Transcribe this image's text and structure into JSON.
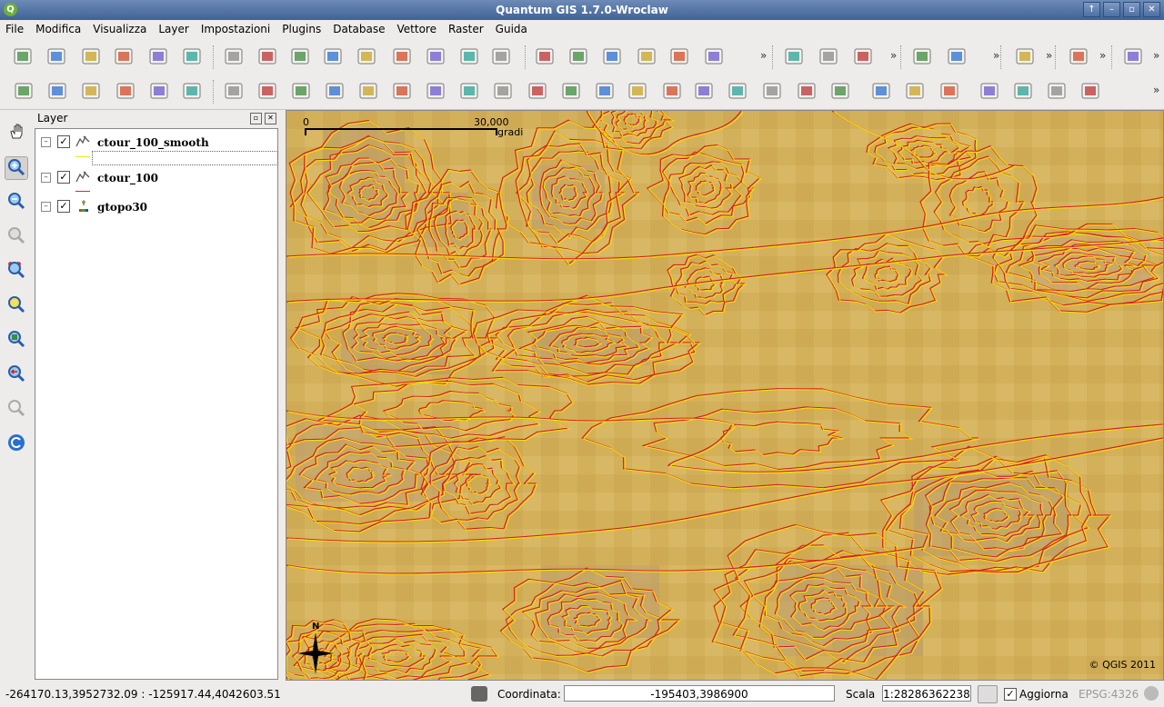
{
  "window": {
    "title": "Quantum GIS 1.7.0-Wroclaw",
    "controls": [
      "↑",
      "–",
      "▫",
      "✕"
    ]
  },
  "menu": [
    "File",
    "Modifica",
    "Visualizza",
    "Layer",
    "Impostazioni",
    "Plugins",
    "Database",
    "Vettore",
    "Raster",
    "Guida"
  ],
  "toolbar1_icons": [
    "new-project-icon",
    "open-project-icon",
    "save-project-icon",
    "save-as-icon",
    "print-composer-icon",
    "print-icon",
    "add-vector-layer-icon",
    "add-raster-layer-icon",
    "add-postgis-layer-icon",
    "add-spatialite-layer-icon",
    "add-wms-layer-icon",
    "new-shapefile-icon",
    "remove-layer-icon",
    "add-wfs-layer-icon",
    "gps-icon",
    "toggle-editing-icon",
    "save-edits-icon",
    "move-feature-icon",
    "node-tool-icon",
    "delete-selected-icon",
    "cut-features-icon",
    "undo-icon",
    "redo-icon",
    "simplify-icon",
    "identify-icon",
    "select-icon",
    "measure-icon",
    "map-tips-icon",
    "spellcheck-icon"
  ],
  "toolbar2_icons": [
    "plugin1-icon",
    "plugin2-icon",
    "plugin3-icon",
    "plugin4-icon",
    "plugin5-icon",
    "plugin6-icon",
    "copyright-icon",
    "north-arrow-plugin-icon",
    "d2s-icon",
    "grass-icon",
    "3d-icon",
    "georeferencer-icon",
    "globe-icon",
    "histogram-icon",
    "north-icon",
    "oracle-icon",
    "raster-icon",
    "color-icon",
    "triangle-icon",
    "scalebar-plugin-icon",
    "geodesic-icon",
    "ferry-icon",
    "bird-icon",
    "image-icon",
    "grass-tools-icon",
    "star-icon",
    "delete-icon",
    "g1-icon",
    "g2-icon",
    "g3-icon",
    "g4-icon",
    "g5-icon"
  ],
  "layers_panel": {
    "title": "Layer",
    "layers": [
      {
        "name": "ctour_100_smooth",
        "checked": "✓",
        "expander": "–",
        "legend_color": "#f2e41c"
      },
      {
        "name": "ctour_100",
        "checked": "✓",
        "expander": "–",
        "legend_color": "#d62b2b"
      },
      {
        "name": "gtopo30",
        "checked": "✓",
        "expander": "–",
        "legend_color": "#3a55c8"
      }
    ]
  },
  "map": {
    "scale_start": "0",
    "scale_end": "30,000",
    "scale_unit": "gradi",
    "north_label": "N",
    "copyright": "© QGIS 2011"
  },
  "status": {
    "extent": "-264170.13,3952732.09 : -125917.44,4042603.51",
    "coord_label": "Coordinata:",
    "coord_value": "-195403,3986900",
    "scale_label": "Scala",
    "scale_value": "1:28286362238",
    "refresh_label": "Aggiorna",
    "refresh_checked": "✓",
    "epsg": "EPSG:4326"
  },
  "colors": {
    "map_background": "#d5b35c",
    "contour_smooth": "#f5dc10",
    "contour_raw": "#d81e1e"
  }
}
